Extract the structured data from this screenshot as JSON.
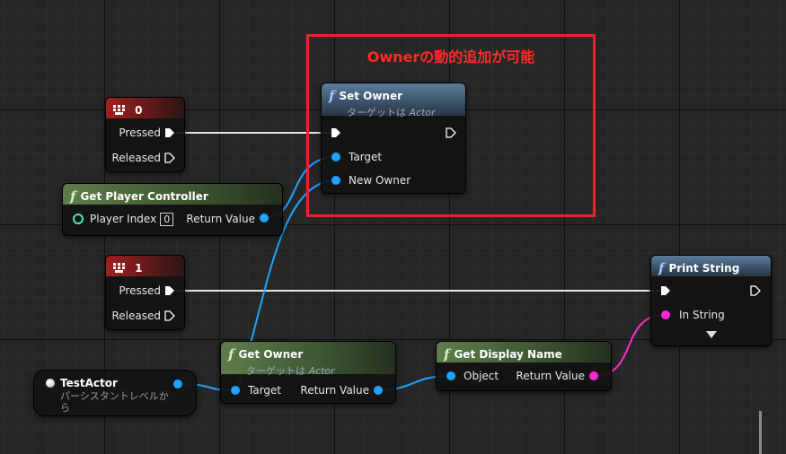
{
  "annotation": {
    "text": "Ownerの動的追加が可能",
    "color": "#e8242d"
  },
  "set_owner": {
    "title": "Set Owner",
    "subtitle_prefix": "ターゲットは",
    "subtitle_class": "Actor",
    "pins": {
      "target": "Target",
      "new_owner": "New Owner"
    }
  },
  "key0": {
    "title": "0",
    "pressed": "Pressed",
    "released": "Released"
  },
  "key1": {
    "title": "1",
    "pressed": "Pressed",
    "released": "Released"
  },
  "get_player_controller": {
    "title": "Get Player Controller",
    "player_index_label": "Player Index",
    "player_index_value": "0",
    "return_value": "Return Value"
  },
  "print_string": {
    "title": "Print String",
    "in_string": "In String"
  },
  "get_owner": {
    "title": "Get Owner",
    "subtitle_prefix": "ターゲットは",
    "subtitle_class": "Actor",
    "target": "Target",
    "return_value": "Return Value"
  },
  "get_display_name": {
    "title": "Get Display Name",
    "object": "Object",
    "return_value": "Return Value"
  },
  "test_actor": {
    "name": "TestActor",
    "description": "パーシスタントレベルから"
  },
  "colors": {
    "object_pin": "#1fa3ff",
    "string_pin": "#ff2bd2",
    "int_pin": "#50e8b0",
    "exec": "#ffffff"
  }
}
